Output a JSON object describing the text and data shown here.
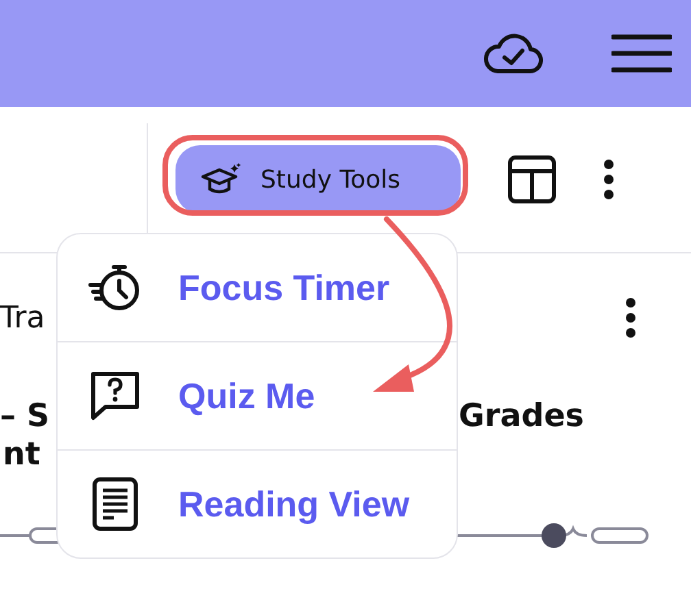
{
  "toolbar": {
    "study_tools_button": {
      "label": "Study Tools"
    }
  },
  "content": {
    "line_1": "Tra",
    "heading_left": "– S",
    "heading_right": "Grades",
    "line_3": "nt"
  },
  "menu": {
    "items": [
      {
        "kind": "timer",
        "label": "Focus Timer"
      },
      {
        "kind": "quiz",
        "label": "Quiz Me"
      },
      {
        "kind": "reading",
        "label": "Reading View"
      }
    ]
  }
}
